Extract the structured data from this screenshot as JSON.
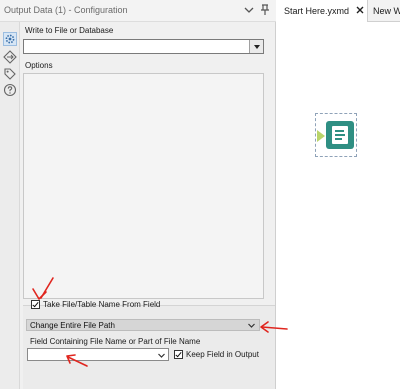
{
  "panel": {
    "title": "Output Data (1) - Configuration"
  },
  "sidebar": {
    "items": [
      {
        "icon": "gear-icon",
        "active": true
      },
      {
        "icon": "connections-icon",
        "active": false
      },
      {
        "icon": "tag-icon",
        "active": false
      },
      {
        "icon": "help-icon",
        "active": false
      }
    ]
  },
  "config": {
    "write_label": "Write to File or Database",
    "write_value": "",
    "options_label": "Options",
    "take_name_label": "Take File/Table Name From Field",
    "take_name_checked": true,
    "change_mode_value": "Change Entire File Path",
    "field_label": "Field Containing File Name or Part of File Name",
    "field_value": "",
    "keep_field_label": "Keep Field in Output",
    "keep_field_checked": true
  },
  "canvas": {
    "tabs": [
      {
        "label": "Start Here.yxmd",
        "closable": true
      },
      {
        "label": "New W"
      }
    ]
  },
  "colors": {
    "annotation": "#e0261f",
    "tool_icon": "#2f8f83",
    "anchor": "#b9d46a"
  }
}
